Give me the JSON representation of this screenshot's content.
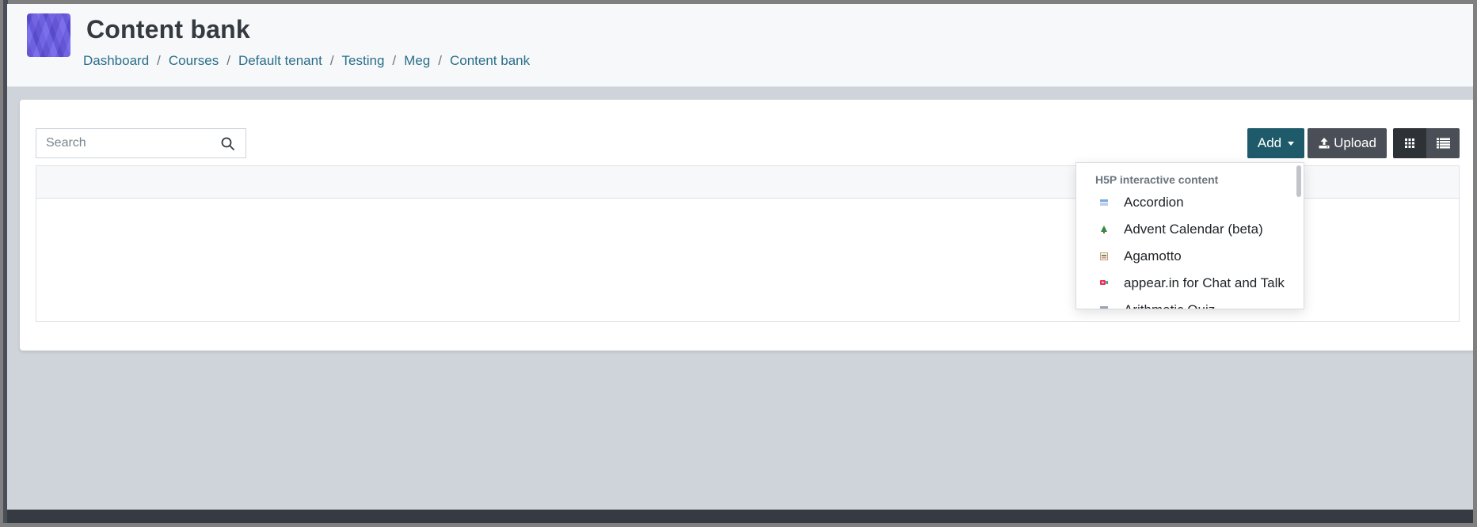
{
  "header": {
    "title": "Content bank",
    "breadcrumb": [
      "Dashboard",
      "Courses",
      "Default tenant",
      "Testing",
      "Meg",
      "Content bank"
    ],
    "separator": "/"
  },
  "toolbar": {
    "search_placeholder": "Search",
    "search_value": "",
    "add_label": "Add",
    "upload_label": "Upload",
    "grid_view_icon": "grid-icon",
    "list_view_icon": "list-icon",
    "active_view": "grid"
  },
  "add_menu": {
    "header": "H5P interactive content",
    "items": [
      {
        "label": "Accordion",
        "icon": "accordion-icon"
      },
      {
        "label": "Advent Calendar (beta)",
        "icon": "tree-icon"
      },
      {
        "label": "Agamotto",
        "icon": "image-sequence-icon"
      },
      {
        "label": "appear.in for Chat and Talk",
        "icon": "chat-icon"
      },
      {
        "label": "Arithmetic Quiz",
        "icon": "quiz-icon"
      }
    ]
  },
  "colors": {
    "primary_button": "#1f5a6b",
    "secondary_button": "#4a4f57",
    "active_toggle": "#2d3236",
    "link": "#2a6e8a",
    "logo": "#6a5ae0"
  }
}
